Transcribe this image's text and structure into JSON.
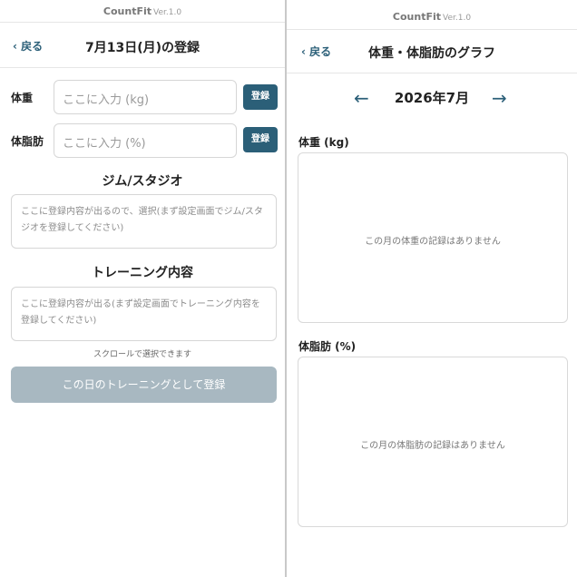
{
  "app": {
    "name": "CountFit",
    "version": "Ver.1.0"
  },
  "registration": {
    "back_label": "‹ 戻る",
    "title": "7月13日(月)の登録",
    "weight": {
      "label": "体重",
      "placeholder": "ここに入力 (kg)",
      "button": "登録"
    },
    "body_fat": {
      "label": "体脂肪",
      "placeholder": "ここに入力 (%)",
      "button": "登録"
    },
    "gym": {
      "title": "ジム/スタジオ",
      "placeholder": "ここに登録内容が出るので、選択(まず設定画面でジム/スタジオを登録してください)"
    },
    "training": {
      "title": "トレーニング内容",
      "placeholder": "ここに登録内容が出る(まず設定画面でトレーニング内容を登録してください)"
    },
    "scroll_hint": "スクロールで選択できます",
    "submit_label": "この日のトレーニングとして登録"
  },
  "graph": {
    "back_label": "‹ 戻る",
    "title": "体重・体脂肪のグラフ",
    "prev_icon": "arrow-left",
    "next_icon": "arrow-right",
    "prev_glyph": "←",
    "next_glyph": "→",
    "month": "2026年7月",
    "weight": {
      "label": "体重 (kg)",
      "empty_message": "この月の体重の記録はありません"
    },
    "body_fat": {
      "label": "体脂肪 (%)",
      "empty_message": "この月の体脂肪の記録はありません"
    }
  },
  "colors": {
    "accent": "#2b5f78",
    "disabled_button": "#a8b8c1",
    "border": "#d6d6d6"
  }
}
